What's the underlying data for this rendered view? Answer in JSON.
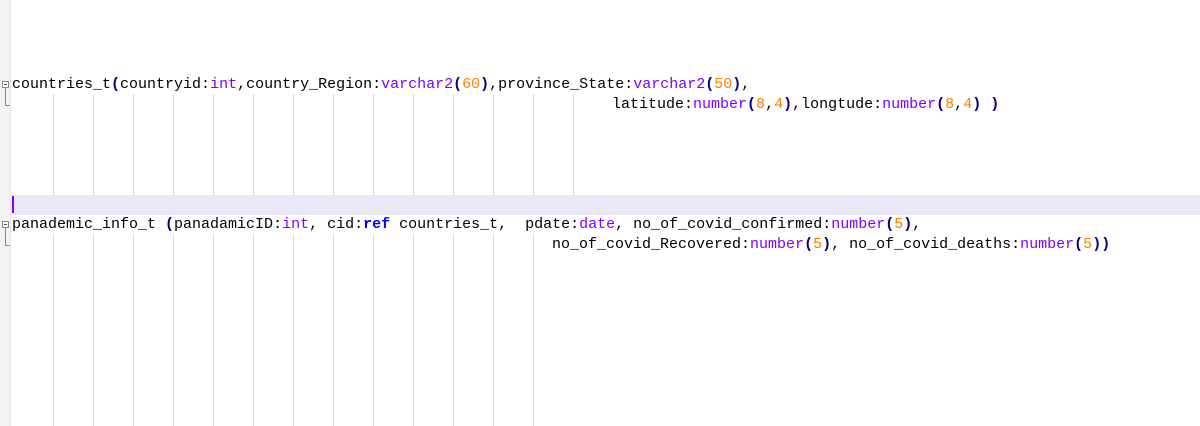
{
  "editor": {
    "lines": {
      "l1": [
        {
          "t": "countries_t",
          "c": "plain"
        },
        {
          "t": "(",
          "c": "op"
        },
        {
          "t": "countryid:",
          "c": "plain"
        },
        {
          "t": "int",
          "c": "type"
        },
        {
          "t": ",country_Region:",
          "c": "plain"
        },
        {
          "t": "varchar2",
          "c": "type"
        },
        {
          "t": "(",
          "c": "op"
        },
        {
          "t": "60",
          "c": "num"
        },
        {
          "t": ")",
          "c": "op"
        },
        {
          "t": ",province_State:",
          "c": "plain"
        },
        {
          "t": "varchar2",
          "c": "type"
        },
        {
          "t": "(",
          "c": "op"
        },
        {
          "t": "50",
          "c": "num"
        },
        {
          "t": ")",
          "c": "op"
        },
        {
          "t": ",",
          "c": "plain"
        }
      ],
      "l2": [
        {
          "t": "latitude:",
          "c": "plain"
        },
        {
          "t": "number",
          "c": "type"
        },
        {
          "t": "(",
          "c": "op"
        },
        {
          "t": "8",
          "c": "num"
        },
        {
          "t": ",",
          "c": "plain"
        },
        {
          "t": "4",
          "c": "num"
        },
        {
          "t": ")",
          "c": "op"
        },
        {
          "t": ",longtude:",
          "c": "plain"
        },
        {
          "t": "number",
          "c": "type"
        },
        {
          "t": "(",
          "c": "op"
        },
        {
          "t": "8",
          "c": "num"
        },
        {
          "t": ",",
          "c": "plain"
        },
        {
          "t": "4",
          "c": "num"
        },
        {
          "t": ")",
          "c": "op"
        },
        {
          "t": " ",
          "c": "plain"
        },
        {
          "t": ")",
          "c": "op"
        }
      ],
      "l3": [
        {
          "t": "panademic_info_t ",
          "c": "plain"
        },
        {
          "t": "(",
          "c": "op"
        },
        {
          "t": "panadamicID:",
          "c": "plain"
        },
        {
          "t": "int",
          "c": "type"
        },
        {
          "t": ", cid:",
          "c": "plain"
        },
        {
          "t": "ref",
          "c": "kw"
        },
        {
          "t": " countries_t,  pdate:",
          "c": "plain"
        },
        {
          "t": "date",
          "c": "type"
        },
        {
          "t": ", no_of_covid_confirmed:",
          "c": "plain"
        },
        {
          "t": "number",
          "c": "type"
        },
        {
          "t": "(",
          "c": "op"
        },
        {
          "t": "5",
          "c": "num"
        },
        {
          "t": ")",
          "c": "op"
        },
        {
          "t": ",",
          "c": "plain"
        }
      ],
      "l4": [
        {
          "t": "no_of_covid_Recovered:",
          "c": "plain"
        },
        {
          "t": "number",
          "c": "type"
        },
        {
          "t": "(",
          "c": "op"
        },
        {
          "t": "5",
          "c": "num"
        },
        {
          "t": ")",
          "c": "op"
        },
        {
          "t": ", no_of_covid_deaths:",
          "c": "plain"
        },
        {
          "t": "number",
          "c": "type"
        },
        {
          "t": "(",
          "c": "op"
        },
        {
          "t": "5",
          "c": "num"
        },
        {
          "t": "))",
          "c": "op"
        }
      ]
    },
    "colors": {
      "plain": "#000000",
      "type": "#8000ff",
      "num": "#ff8000",
      "op": "#000080",
      "kw": "#0000ff",
      "current_line": "#e8e8f8"
    }
  }
}
